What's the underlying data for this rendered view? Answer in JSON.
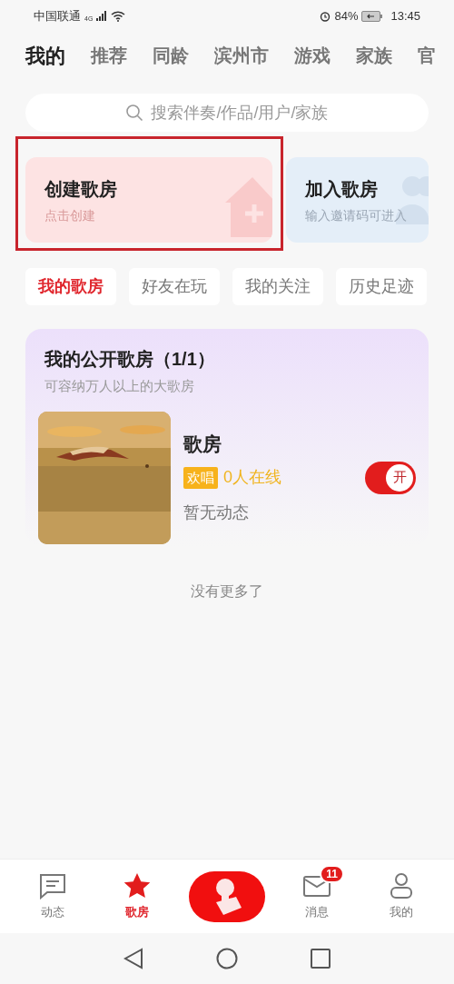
{
  "status_bar": {
    "carrier": "中国联通",
    "network": "4G",
    "battery": "84%",
    "time": "13:45"
  },
  "top_tabs": [
    {
      "label": "我的",
      "selected": true
    },
    {
      "label": "推荐",
      "selected": false
    },
    {
      "label": "同龄",
      "selected": false
    },
    {
      "label": "滨州市",
      "selected": false
    },
    {
      "label": "游戏",
      "selected": false
    },
    {
      "label": "家族",
      "selected": false
    },
    {
      "label": "官",
      "selected": false
    }
  ],
  "search": {
    "placeholder": "搜索伴奏/作品/用户/家族"
  },
  "action_cards": [
    {
      "kind": "create",
      "title": "创建歌房",
      "subtitle": "点击创建",
      "highlighted": true
    },
    {
      "kind": "join",
      "title": "加入歌房",
      "subtitle": "输入邀请码可进入",
      "highlighted": false
    }
  ],
  "room_tabs": [
    {
      "label": "我的歌房",
      "selected": true
    },
    {
      "label": "好友在玩",
      "selected": false
    },
    {
      "label": "我的关注",
      "selected": false
    },
    {
      "label": "历史足迹",
      "selected": false
    }
  ],
  "public_rooms": {
    "title": "我的公开歌房（1/1）",
    "subtitle": "可容纳万人以上的大歌房",
    "rooms": [
      {
        "name": "歌房",
        "tag": "欢唱",
        "online": "0人在线",
        "activity": "暂无动态",
        "switch_label": "开",
        "on": true
      }
    ]
  },
  "end_note": "没有更多了",
  "bottom_nav": [
    {
      "kind": "feed",
      "label": "动态",
      "selected": false
    },
    {
      "kind": "room",
      "label": "歌房",
      "selected": true
    },
    {
      "kind": "center"
    },
    {
      "kind": "messages",
      "label": "消息",
      "badge": "11",
      "selected": false
    },
    {
      "kind": "profile",
      "label": "我的",
      "selected": false
    }
  ]
}
